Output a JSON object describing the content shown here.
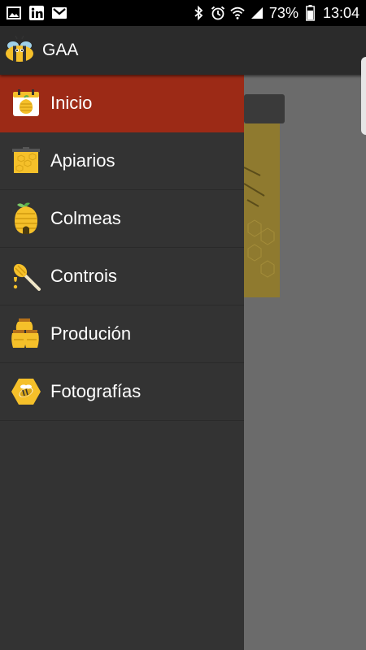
{
  "status_bar": {
    "battery": "73%",
    "time": "13:04",
    "icons": [
      "gallery-icon",
      "linkedin-icon",
      "gmail-icon",
      "bluetooth-icon",
      "alarm-icon",
      "wifi-icon",
      "signal-icon",
      "battery-icon"
    ]
  },
  "app_bar": {
    "title": "GAA",
    "logo_icon": "bee-logo-icon"
  },
  "drawer": {
    "active_color": "#9c2a16",
    "items": [
      {
        "label": "Inicio",
        "icon": "calendar-hive-icon",
        "active": true
      },
      {
        "label": "Apiarios",
        "icon": "honeycomb-box-icon",
        "active": false
      },
      {
        "label": "Colmeas",
        "icon": "beehive-icon",
        "active": false
      },
      {
        "label": "Controis",
        "icon": "honey-dipper-icon",
        "active": false
      },
      {
        "label": "Produción",
        "icon": "honey-jars-icon",
        "active": false
      },
      {
        "label": "Fotografías",
        "icon": "bee-honeycomb-icon",
        "active": false
      }
    ]
  },
  "colors": {
    "honey": "#f5c02a",
    "drawer_bg": "#333333",
    "appbar_bg": "#2b2b2b"
  }
}
